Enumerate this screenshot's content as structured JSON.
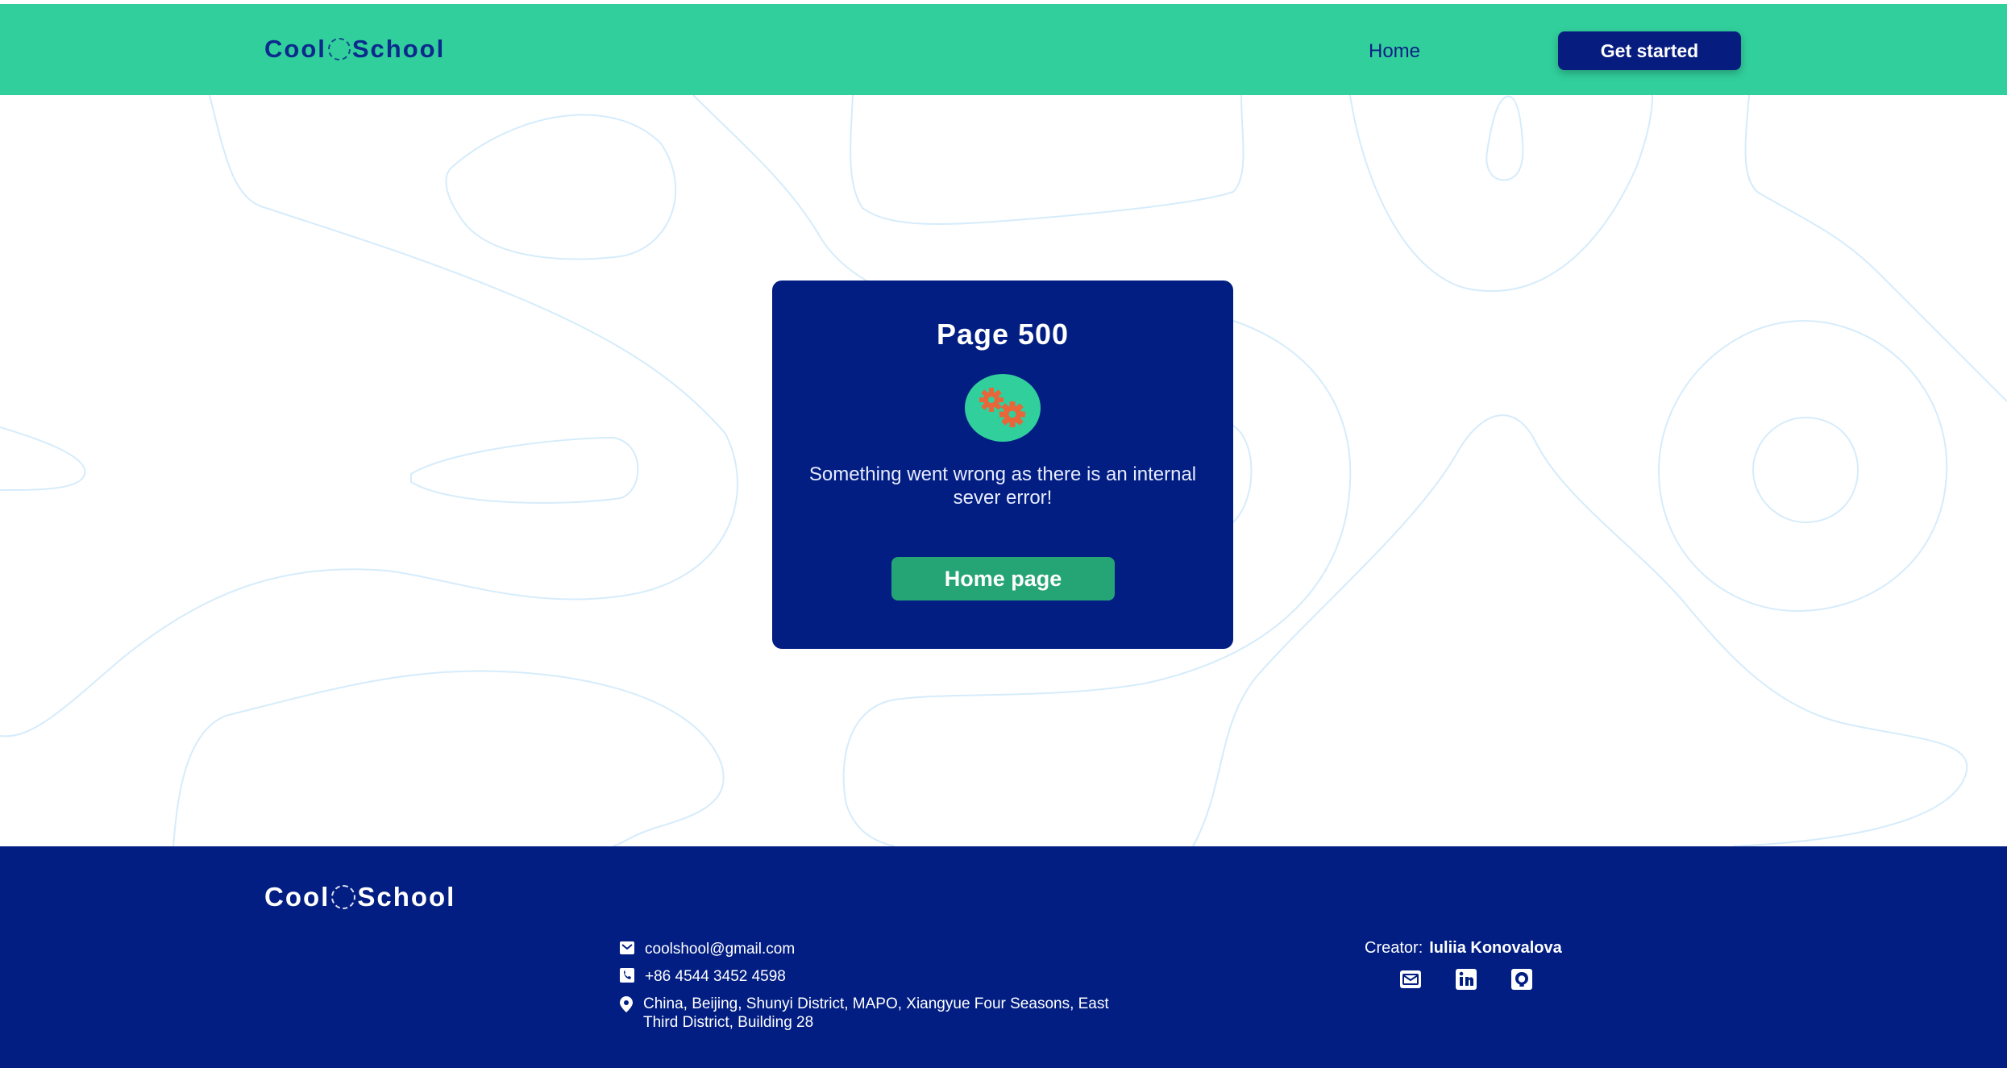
{
  "header": {
    "logo_left": "Cool",
    "logo_right": "School",
    "nav_home": "Home",
    "get_started": "Get started"
  },
  "card": {
    "title": "Page 500",
    "message": "Something went wrong as there is an internal sever error!",
    "home_button": "Home page",
    "icon": "gears-icon"
  },
  "footer": {
    "logo_left": "Cool",
    "logo_right": "School",
    "email": "coolshool@gmail.com",
    "phone": "+86 4544 3452 4598",
    "address": "China, Beijing, Shunyi District, MAPO, Xiangyue Four Seasons, East Third District, Building 28",
    "creator_label": "Creator:",
    "creator_name": "Iuliia Konovalova",
    "social_icons": [
      "mail-icon",
      "linkedin-icon",
      "github-icon"
    ]
  },
  "colors": {
    "header_bg": "#31cf9c",
    "navy": "#021e82",
    "button_green": "#25a475",
    "gear_orange": "#e8663a",
    "background_line": "#d6ecfb"
  }
}
